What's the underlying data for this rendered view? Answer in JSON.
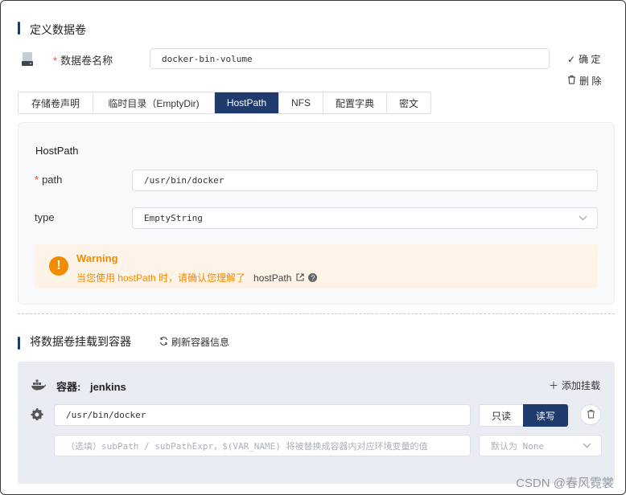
{
  "section1": {
    "title": "定义数据卷"
  },
  "volume": {
    "name_label": "数据卷名称",
    "name_value": "docker-bin-volume",
    "confirm": "确 定",
    "delete": "删 除"
  },
  "tabs": [
    "存储卷声明",
    "临时目录（EmptyDir)",
    "HostPath",
    "NFS",
    "配置字典",
    "密文"
  ],
  "active_tab": "HostPath",
  "hostpath": {
    "title": "HostPath",
    "path_label": "path",
    "path_value": "/usr/bin/docker",
    "type_label": "type",
    "type_value": "EmptyString"
  },
  "warning": {
    "title": "Warning",
    "text": "当您使用 hostPath 时，请确认您理解了",
    "link": "hostPath"
  },
  "section2": {
    "title": "将数据卷挂载到容器",
    "refresh": "刷新容器信息"
  },
  "container": {
    "label": "容器:",
    "name": "jenkins",
    "add_mount": "添加挂载",
    "mount_path": "/usr/bin/docker",
    "readonly": "只读",
    "readwrite": "读写",
    "subpath_placeholder": "（选填）subPath / subPathExpr，$(VAR_NAME) 将被替换成容器内对应环境变量的值",
    "subpath_type": "默认为 None"
  },
  "watermark": "CSDN @春风霓裳",
  "colors": {
    "primary": "#1f3a6d",
    "warning": "#f38b00",
    "required": "#e0453a"
  }
}
